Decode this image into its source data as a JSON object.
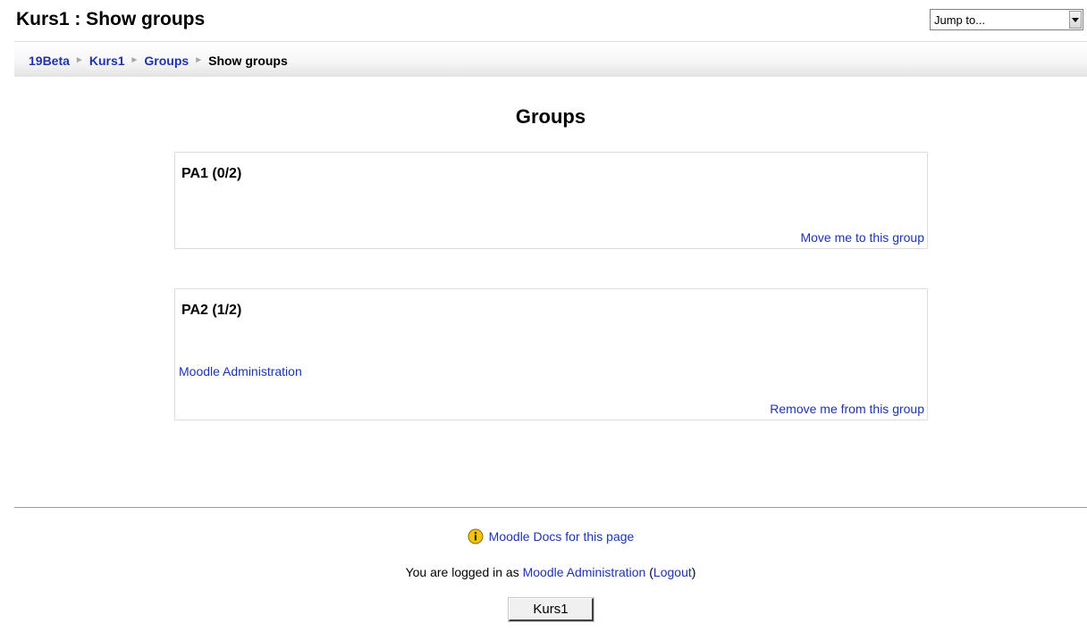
{
  "header": {
    "title": "Kurs1 : Show groups",
    "jump_select": {
      "value": "Jump to..."
    }
  },
  "breadcrumb": {
    "items": [
      "19Beta",
      "Kurs1",
      "Groups"
    ],
    "current": "Show groups",
    "separator": "►"
  },
  "main": {
    "title": "Groups",
    "groups": [
      {
        "name": "PA1 (0/2)",
        "members": [],
        "action": "Move me to this group"
      },
      {
        "name": "PA2 (1/2)",
        "members": [
          "Moodle Administration"
        ],
        "action": "Remove me from this group"
      }
    ]
  },
  "footer": {
    "docs_link": "Moodle Docs for this page",
    "login_prefix": "You are logged in as ",
    "user_name": "Moodle Administration",
    "logout_open": " (",
    "logout_label": "Logout",
    "logout_close": ")",
    "course_button": "Kurs1"
  },
  "colors": {
    "link": "#1e33b0",
    "info_icon": "#f2c40f"
  },
  "icons": {
    "select_arrow": "chevron-down-icon",
    "docs": "info-icon"
  }
}
